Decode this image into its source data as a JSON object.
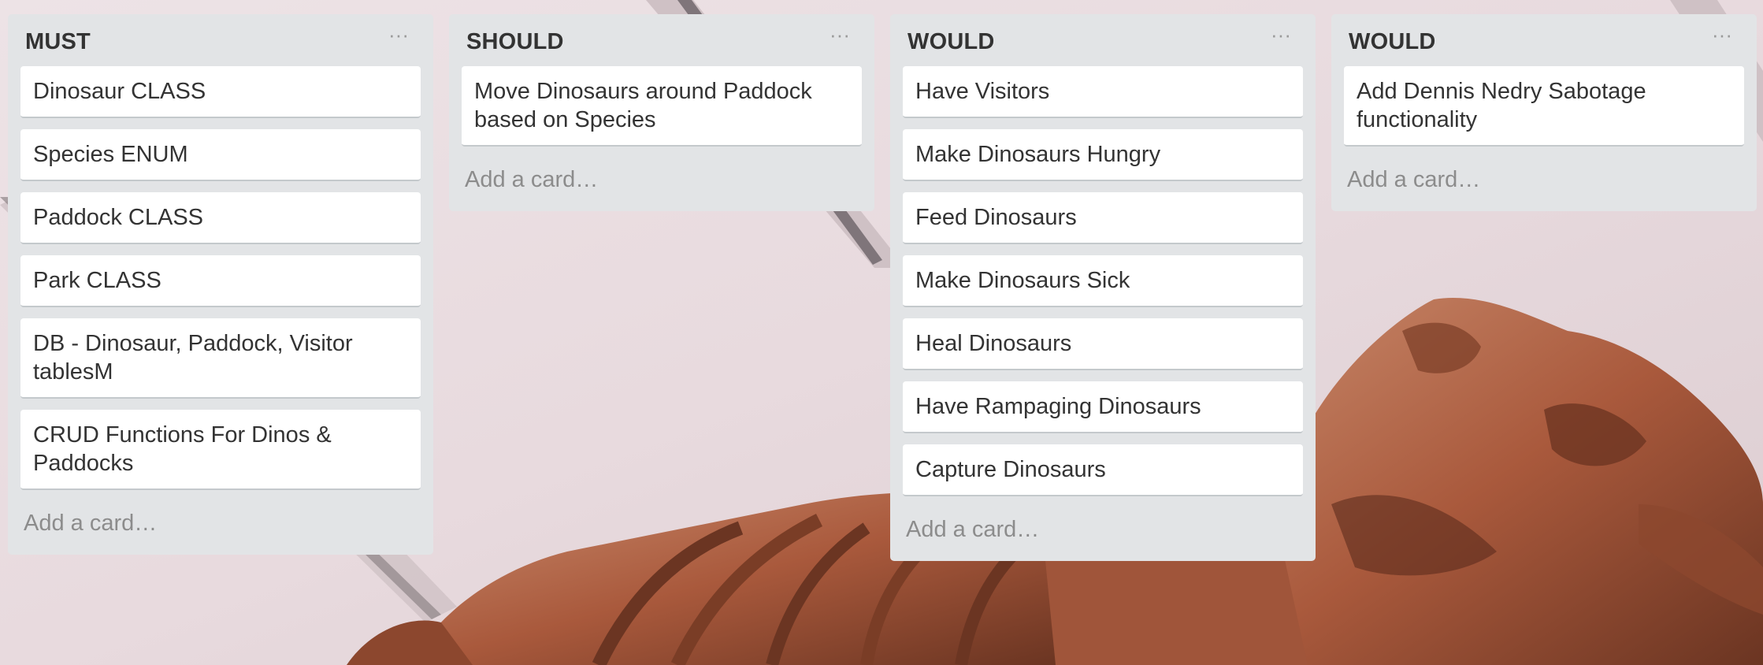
{
  "lists": [
    {
      "title": "MUST",
      "menu_icon": "more-horizontal-icon",
      "cards": [
        "Dinosaur CLASS",
        "Species ENUM",
        "Paddock CLASS",
        "Park CLASS",
        "DB - Dinosaur, Paddock, Visitor tablesM",
        "CRUD Functions For Dinos & Paddocks"
      ],
      "add_label": "Add a card…"
    },
    {
      "title": "SHOULD",
      "menu_icon": "more-horizontal-icon",
      "cards": [
        "Move Dinosaurs around Paddock based on Species"
      ],
      "add_label": "Add a card…"
    },
    {
      "title": "WOULD",
      "menu_icon": "more-horizontal-icon",
      "cards": [
        "Have Visitors",
        "Make Dinosaurs Hungry",
        "Feed Dinosaurs",
        "Make Dinosaurs Sick",
        "Heal Dinosaurs",
        "Have Rampaging Dinosaurs",
        "Capture Dinosaurs"
      ],
      "add_label": "Add a card…"
    },
    {
      "title": "WOULD",
      "menu_icon": "more-horizontal-icon",
      "cards": [
        "Add Dennis Nedry Sabotage functionality"
      ],
      "add_label": "Add a card…"
    }
  ],
  "menu_glyph": "···",
  "colors": {
    "list_background": "#e2e4e6",
    "card_background": "#ffffff",
    "title_text": "#333333",
    "add_card_text": "#8c8c8c",
    "fossil": "#b0664a"
  }
}
